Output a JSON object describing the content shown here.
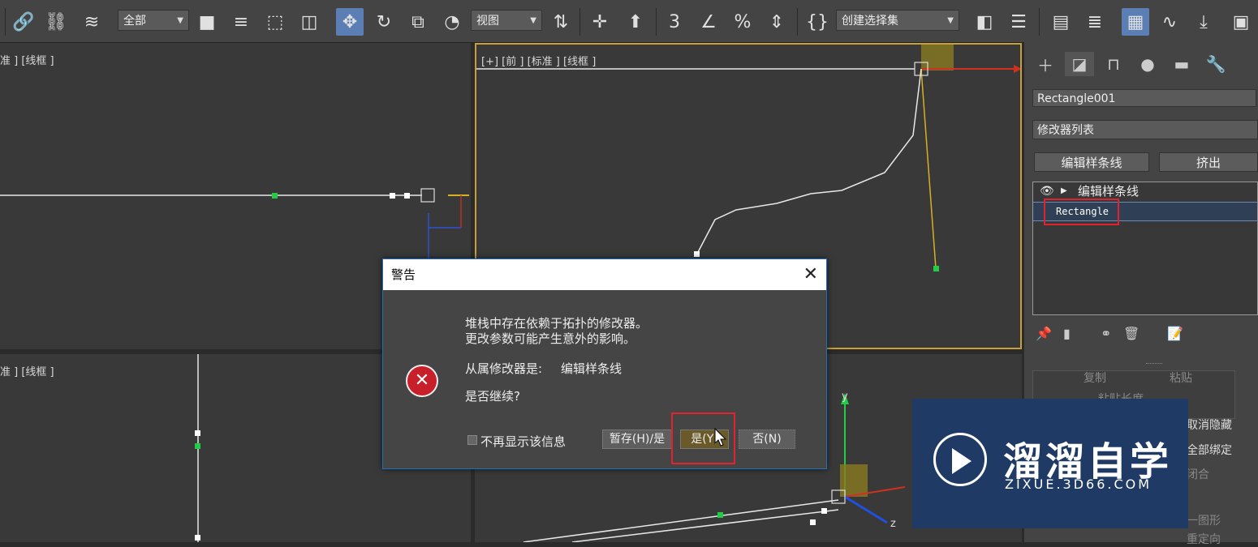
{
  "toolbar": {
    "selection_filter": "全部",
    "ref_coord": "视图",
    "snap_label": "3",
    "named_selection_placeholder": "创建选择集"
  },
  "viewports": {
    "top_left_label": "准 ] [线框 ]",
    "front_label": "[+] [前 ] [标准 ] [线框 ]",
    "bottom_left_label": "准 ] [线框 ]",
    "axis_y": "y",
    "axis_z": "z"
  },
  "command_panel": {
    "object_name": "Rectangle001",
    "modifier_list": "修改器列表",
    "btn_edit_spline": "编辑样条线",
    "btn_extrude": "挤出",
    "stack_items": [
      "编辑样条线",
      "Rectangle"
    ],
    "rollout_copy": "复制",
    "rollout_paste": "粘贴",
    "rollout_paste_length": "粘贴长度",
    "right_cut_1": "取消隐藏",
    "right_cut_2": "全部绑定",
    "right_cut_3": "闭合",
    "right_cut_4": "一图形",
    "right_cut_5": "重定向"
  },
  "dialog": {
    "title": "警告",
    "line1": "堆栈中存在依赖于拓扑的修改器。",
    "line2": "更改参数可能产生意外的影响。",
    "dependent_label": "从属修改器是:",
    "dependent_value": "编辑样条线",
    "continue_question": "是否继续?",
    "dont_show_again": "不再显示该信息",
    "btn_hold_yes": "暂存(H)/是",
    "btn_yes": "是(Y)",
    "btn_no": "否(N)"
  },
  "watermark": {
    "brand_cn": "溜溜自学",
    "brand_url": "ZIXUE.3D66.COM"
  },
  "colors": {
    "accent_blue": "#5b7fb5",
    "highlight_red": "#e0232e",
    "error_red": "#c8202a",
    "spline_white": "#e8e8e8",
    "vertex_green": "#22cc44",
    "axis_yellow": "#d8b020"
  }
}
